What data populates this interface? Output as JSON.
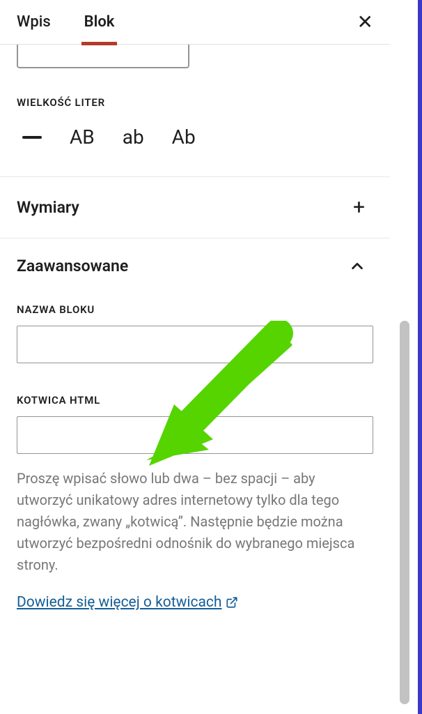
{
  "tabs": {
    "post": "Wpis",
    "block": "Blok"
  },
  "letterCase": {
    "label": "Wielkość liter",
    "options": {
      "upper": "AB",
      "lower": "ab",
      "capitalize": "Ab"
    }
  },
  "dimensions": {
    "title": "Wymiary"
  },
  "advanced": {
    "title": "Zaawansowane",
    "blockName": {
      "label": "Nazwa bloku",
      "value": ""
    },
    "htmlAnchor": {
      "label": "Kotwica HTML",
      "value": "",
      "help": "Proszę wpisać słowo lub dwa – bez spacji – aby utworzyć unikatowy adres internetowy tylko dla tego nagłówka, zwany „kotwicą”. Następnie będzie można utworzyć bezpośredni odnośnik do wybranego miejsca strony.",
      "learnMore": "Dowiedz się więcej o kotwicach"
    }
  }
}
